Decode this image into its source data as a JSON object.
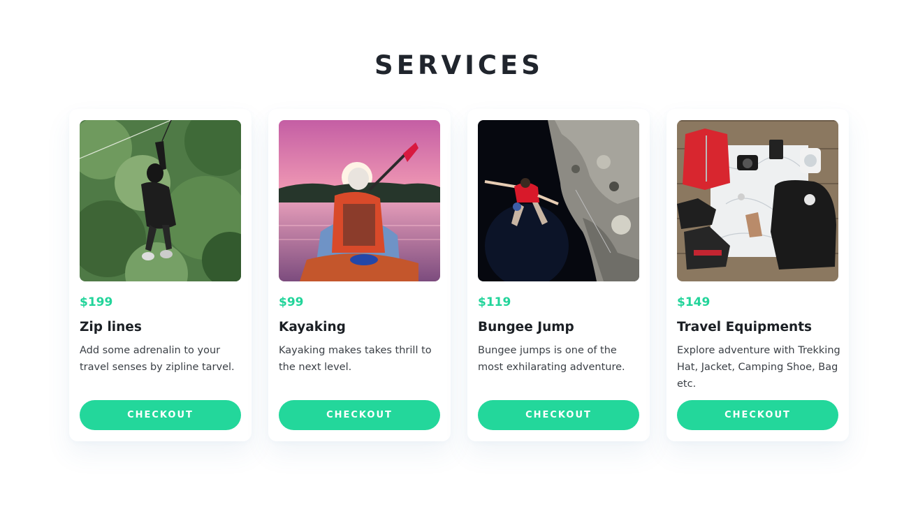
{
  "section": {
    "title": "SERVICES"
  },
  "colors": {
    "accent": "#23d79b",
    "price": "#22d49a",
    "text": "#1b1f24"
  },
  "services": [
    {
      "price": "$199",
      "name": "Zip lines",
      "description": "Add some adrenalin to your travel senses by zipline tarvel.",
      "button": "CHECKOUT",
      "image": "zipline-photo"
    },
    {
      "price": "$99",
      "name": "Kayaking",
      "description": "Kayaking makes takes thrill to the next level.",
      "button": "CHECKOUT",
      "image": "kayaking-photo"
    },
    {
      "price": "$119",
      "name": "Bungee Jump",
      "description": "Bungee jumps is one of the most exhilarating adventure.",
      "button": "CHECKOUT",
      "image": "climbing-photo"
    },
    {
      "price": "$149",
      "name": "Travel Equipments",
      "description": "Explore adventure with Trekking Hat, Jacket, Camping Shoe, Bag etc.",
      "button": "CHECKOUT",
      "image": "travel-gear-photo"
    }
  ]
}
